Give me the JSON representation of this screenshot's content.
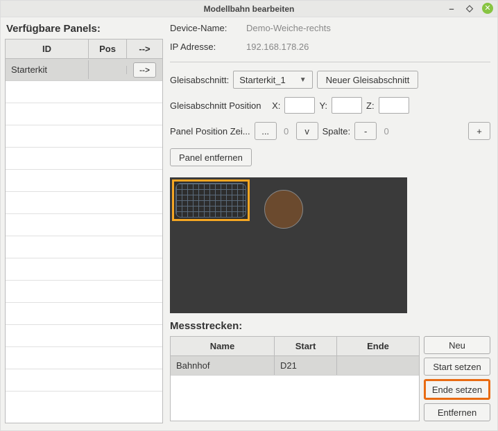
{
  "window": {
    "title": "Modellbahn bearbeiten"
  },
  "left": {
    "header": "Verfügbare Panels:",
    "columns": {
      "id": "ID",
      "pos": "Pos",
      "action": "-->"
    },
    "rows": [
      {
        "id": "Starterkit",
        "pos": "",
        "action": "-->"
      }
    ]
  },
  "device": {
    "name_label": "Device-Name:",
    "name_value": "Demo-Weiche-rechts",
    "ip_label": "IP Adresse:",
    "ip_value": "192.168.178.26"
  },
  "gleisabschnitt": {
    "label": "Gleisabschnitt:",
    "selected": "Starterkit_1",
    "new_btn": "Neuer Gleisabschnitt",
    "pos_label": "Gleisabschnitt Position",
    "x_label": "X:",
    "y_label": "Y:",
    "z_label": "Z:"
  },
  "panel_pos": {
    "label": "Panel Position  Zei...",
    "more_btn": "...",
    "row_value": "0",
    "v_btn": "v",
    "col_label": "Spalte:",
    "minus_btn": "-",
    "col_value": "0",
    "plus_btn": "+"
  },
  "panel_remove_btn": "Panel entfernen",
  "messstrecken": {
    "header": "Messstrecken:",
    "columns": {
      "name": "Name",
      "start": "Start",
      "end": "Ende"
    },
    "rows": [
      {
        "name": "Bahnhof",
        "start": "D21",
        "end": ""
      }
    ],
    "buttons": {
      "new": "Neu",
      "set_start": "Start setzen",
      "set_end": "Ende setzen",
      "remove": "Entfernen"
    }
  }
}
